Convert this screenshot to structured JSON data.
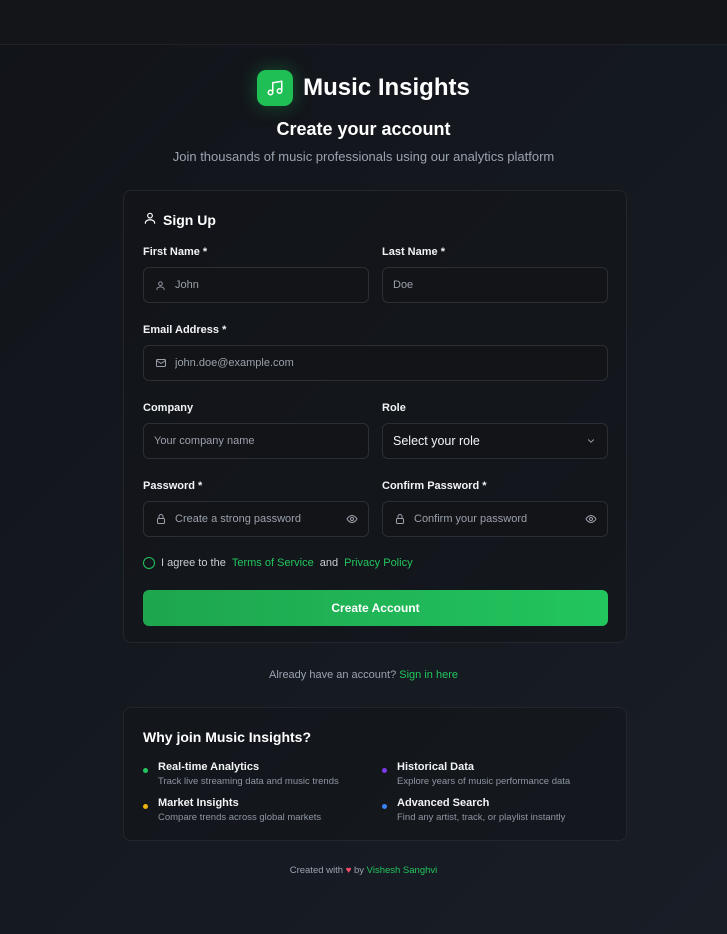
{
  "app": {
    "name": "Music Insights"
  },
  "header": {
    "title": "Create your account",
    "subtitle": "Join thousands of music professionals using our analytics platform"
  },
  "form": {
    "title": "Sign Up",
    "first_name": {
      "label": "First Name *",
      "placeholder": "John"
    },
    "last_name": {
      "label": "Last Name *",
      "placeholder": "Doe"
    },
    "email": {
      "label": "Email Address *",
      "placeholder": "john.doe@example.com"
    },
    "company": {
      "label": "Company",
      "placeholder": "Your company name"
    },
    "role": {
      "label": "Role",
      "value": "Select your role"
    },
    "password": {
      "label": "Password *",
      "placeholder": "Create a strong password"
    },
    "confirm_password": {
      "label": "Confirm Password *",
      "placeholder": "Confirm your password"
    },
    "agree": {
      "prefix": "I agree to the",
      "terms": "Terms of Service",
      "and": "and",
      "privacy": "Privacy Policy"
    },
    "submit_label": "Create Account"
  },
  "signin": {
    "prompt": "Already have an account?",
    "link": "Sign in here"
  },
  "why": {
    "title": "Why join Music Insights?",
    "features": [
      {
        "title": "Real-time Analytics",
        "desc": "Track live streaming data and music trends",
        "color": "#22c55e"
      },
      {
        "title": "Historical Data",
        "desc": "Explore years of music performance data",
        "color": "#7c3aed"
      },
      {
        "title": "Market Insights",
        "desc": "Compare trends across global markets",
        "color": "#eab308"
      },
      {
        "title": "Advanced Search",
        "desc": "Find any artist, track, or playlist instantly",
        "color": "#3b82f6"
      }
    ]
  },
  "footer": {
    "prefix": "Created with",
    "heart": "♥",
    "by": "by",
    "author": "Vishesh Sanghvi"
  },
  "colors": {
    "accent": "#22c55e",
    "heart": "#ff4d6d"
  },
  "icons": [
    "music-note-icon",
    "user-icon",
    "mail-icon",
    "lock-icon",
    "eye-icon",
    "chevron-down-icon",
    "heart-icon"
  ]
}
